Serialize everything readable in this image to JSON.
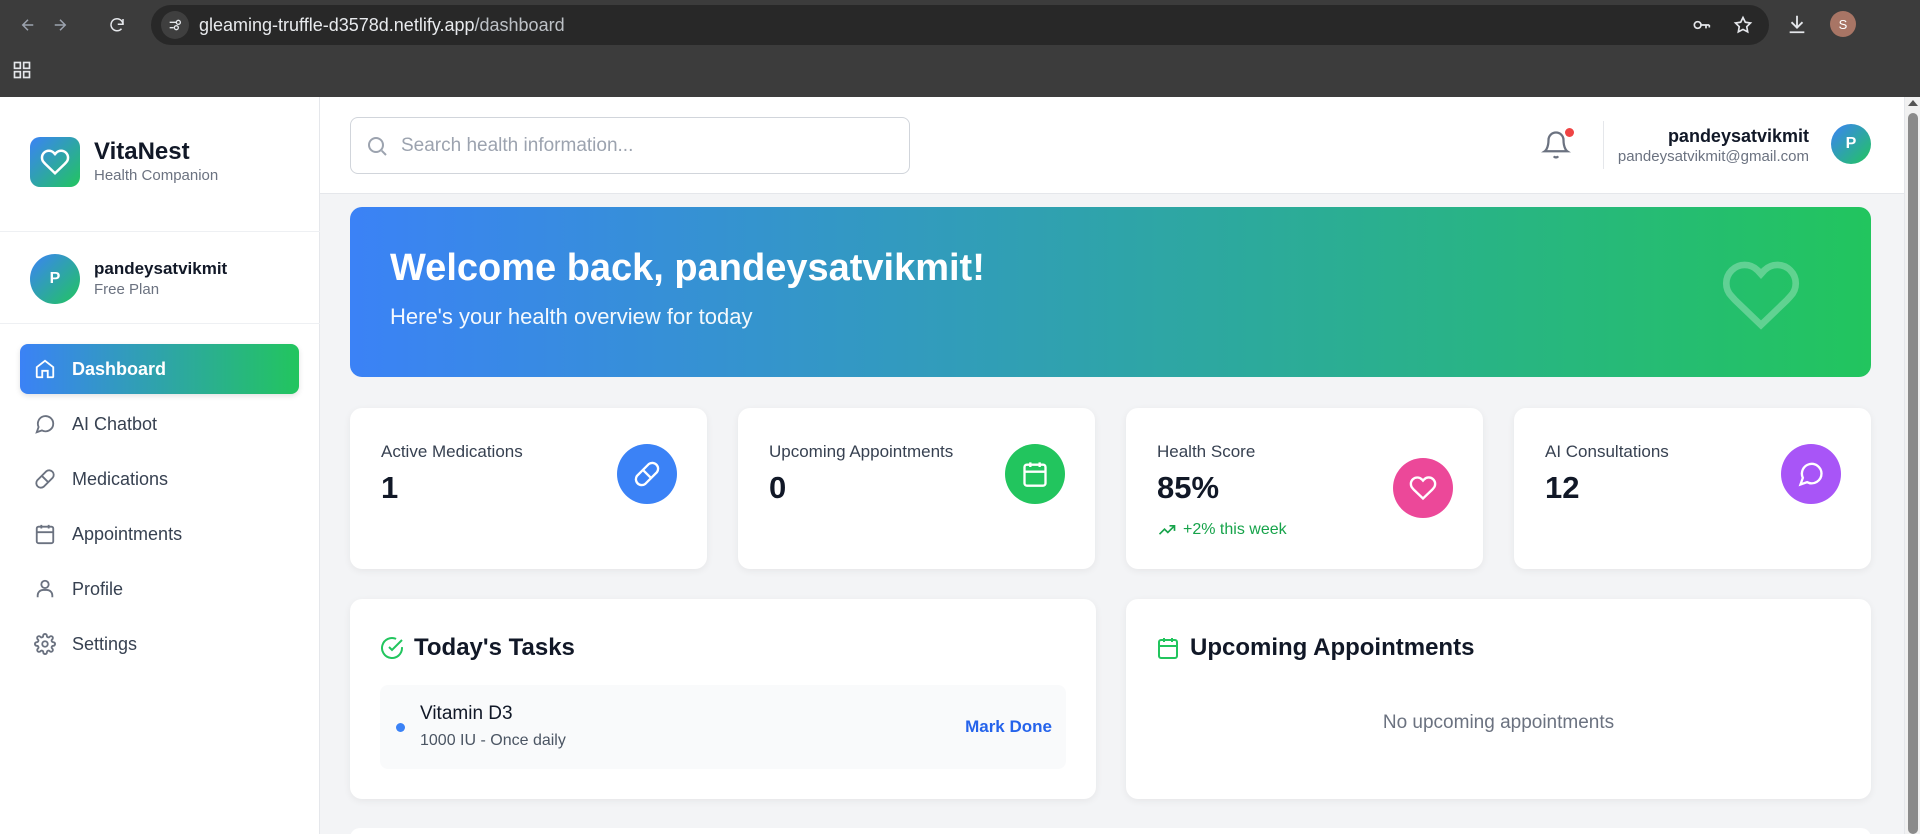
{
  "browser": {
    "url_host": "gleaming-truffle-d3578d.netlify.app",
    "url_path": "/dashboard",
    "profile_initial": "S"
  },
  "brand": {
    "name": "VitaNest",
    "subtitle": "Health Companion"
  },
  "sidebar_user": {
    "initial": "P",
    "name": "pandeysatvikmit",
    "plan": "Free Plan"
  },
  "nav": [
    {
      "label": "Dashboard",
      "icon": "home-icon",
      "active": true
    },
    {
      "label": "AI Chatbot",
      "icon": "chat-icon",
      "active": false
    },
    {
      "label": "Medications",
      "icon": "pill-icon",
      "active": false
    },
    {
      "label": "Appointments",
      "icon": "calendar-icon",
      "active": false
    },
    {
      "label": "Profile",
      "icon": "user-icon",
      "active": false
    },
    {
      "label": "Settings",
      "icon": "gear-icon",
      "active": false
    }
  ],
  "search": {
    "placeholder": "Search health information..."
  },
  "header_user": {
    "name": "pandeysatvikmit",
    "email": "pandeysatvikmit@gmail.com",
    "initial": "P"
  },
  "hero": {
    "title": "Welcome back, pandeysatvikmit!",
    "subtitle": "Here's your health overview for today"
  },
  "stats": [
    {
      "label": "Active Medications",
      "value": "1",
      "color": "#3b82f6",
      "icon": "pill-icon"
    },
    {
      "label": "Upcoming Appointments",
      "value": "0",
      "color": "#22c55e",
      "icon": "calendar-icon"
    },
    {
      "label": "Health Score",
      "value": "85%",
      "trend": "+2% this week",
      "color": "#ec4899",
      "icon": "heart-icon"
    },
    {
      "label": "AI Consultations",
      "value": "12",
      "color": "#a855f7",
      "icon": "chat-icon"
    }
  ],
  "tasks_panel": {
    "title": "Today's Tasks",
    "tasks": [
      {
        "name": "Vitamin D3",
        "detail": "1000 IU - Once daily",
        "action": "Mark Done"
      }
    ]
  },
  "appointments_panel": {
    "title": "Upcoming Appointments",
    "empty_text": "No upcoming appointments"
  },
  "colors": {
    "brand_blue": "#3b82f6",
    "brand_green": "#22c55e",
    "link_blue": "#2563eb",
    "notification": "#ef4444"
  }
}
